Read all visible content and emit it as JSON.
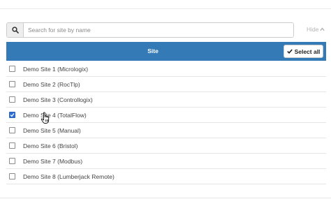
{
  "search": {
    "placeholder": "Search for site by name",
    "value": "",
    "icon": "search-icon"
  },
  "hide_toggle": {
    "label": "Hide",
    "icon": "chevron-up-icon"
  },
  "table": {
    "header": "Site",
    "select_all_label": "Select all",
    "select_all_icon": "check-icon",
    "header_color": "#337ab7"
  },
  "sites": [
    {
      "label": "Demo Site 1 (Micrologix)",
      "checked": false
    },
    {
      "label": "Demo Site 2 (RocTlp)",
      "checked": false
    },
    {
      "label": "Demo Site 3 (Controllogix)",
      "checked": false
    },
    {
      "label": "Demo Site 4 (TotalFlow)",
      "checked": true
    },
    {
      "label": "Demo Site 5 (Manual)",
      "checked": false
    },
    {
      "label": "Demo Site 6 (Bristol)",
      "checked": false
    },
    {
      "label": "Demo Site 7 (Modbus)",
      "checked": false
    },
    {
      "label": "Demo Site 8 (Lumberjack Remote)",
      "checked": false
    }
  ]
}
